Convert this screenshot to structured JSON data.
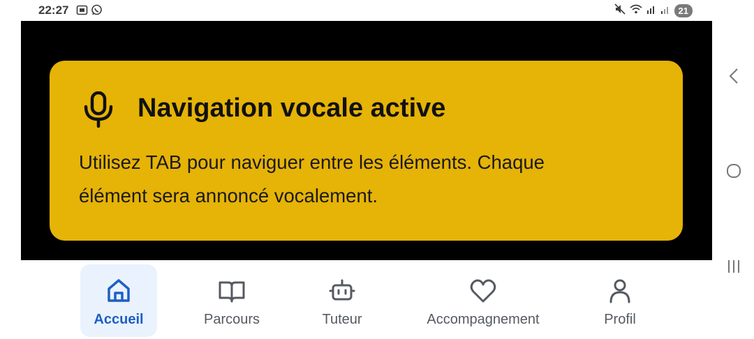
{
  "status_bar": {
    "time": "22:27",
    "left_icons": [
      "screenshot-icon",
      "whatsapp-icon"
    ],
    "right_icons": [
      "mute-icon",
      "wifi-icon",
      "signal-icon",
      "signal-weak-icon"
    ],
    "battery": "21"
  },
  "voice_card": {
    "icon": "microphone-icon",
    "title": "Navigation vocale active",
    "body_line1": "Utilisez TAB pour naviguer entre les éléments. Chaque",
    "body_line2": "élément sera annoncé vocalement.",
    "background": "#e6b307"
  },
  "bottom_nav": {
    "active_color": "#1d5fc4",
    "items": [
      {
        "label": "Accueil",
        "icon": "home-icon",
        "active": true
      },
      {
        "label": "Parcours",
        "icon": "book-icon",
        "active": false
      },
      {
        "label": "Tuteur",
        "icon": "robot-icon",
        "active": false
      },
      {
        "label": "Accompagnement",
        "icon": "heart-icon",
        "active": false
      },
      {
        "label": "Profil",
        "icon": "user-icon",
        "active": false
      }
    ]
  },
  "system_nav": {
    "buttons": [
      "back-icon",
      "home-circle-icon",
      "recents-icon"
    ]
  }
}
